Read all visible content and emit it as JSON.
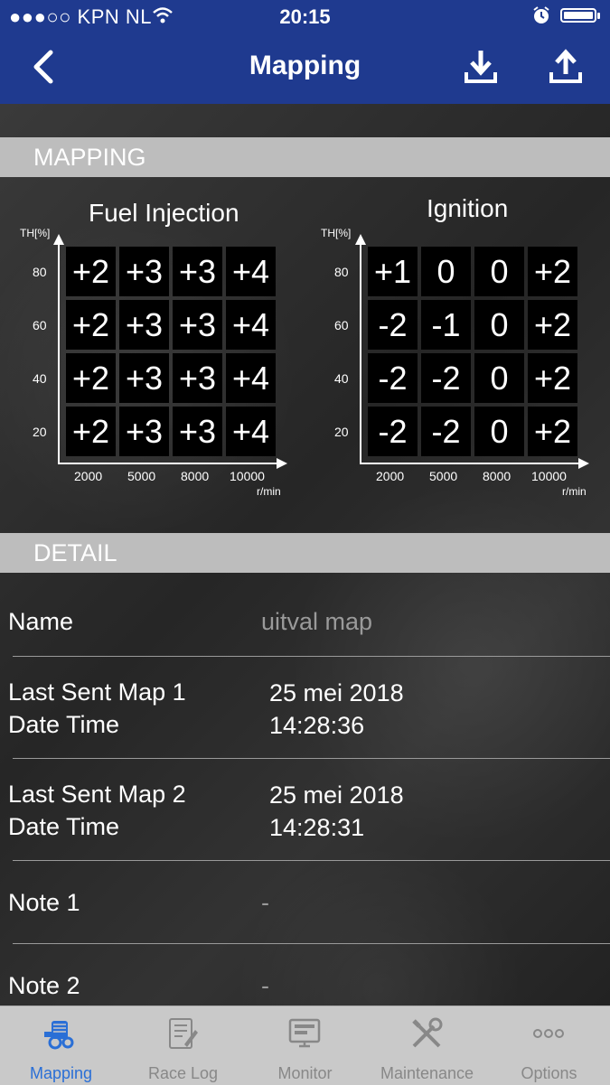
{
  "status_bar": {
    "carrier": "●●●○○ KPN NL",
    "time": "20:15"
  },
  "nav": {
    "title": "Mapping",
    "back_icon": "chevron-left-icon",
    "download_icon": "download-icon",
    "upload_icon": "upload-icon"
  },
  "mapping": {
    "header": "MAPPING",
    "fuel": {
      "title": "Fuel Injection",
      "y_unit": "TH[%]",
      "x_unit": "r/min",
      "y_ticks": [
        "80",
        "60",
        "40",
        "20"
      ],
      "x_ticks": [
        "2000",
        "5000",
        "8000",
        "10000"
      ],
      "rows": [
        [
          "+2",
          "+3",
          "+3",
          "+4"
        ],
        [
          "+2",
          "+3",
          "+3",
          "+4"
        ],
        [
          "+2",
          "+3",
          "+3",
          "+4"
        ],
        [
          "+2",
          "+3",
          "+3",
          "+4"
        ]
      ]
    },
    "ignition": {
      "title": "Ignition",
      "y_unit": "TH[%]",
      "x_unit": "r/min",
      "y_ticks": [
        "80",
        "60",
        "40",
        "20"
      ],
      "x_ticks": [
        "2000",
        "5000",
        "8000",
        "10000"
      ],
      "rows": [
        [
          "+1",
          "0",
          "0",
          "+2"
        ],
        [
          "-2",
          "-1",
          "0",
          "+2"
        ],
        [
          "-2",
          "-2",
          "0",
          "+2"
        ],
        [
          "-2",
          "-2",
          "0",
          "+2"
        ]
      ]
    }
  },
  "detail": {
    "header": "DETAIL",
    "name_label": "Name",
    "name_value": "uitval map",
    "map1_label_1": "Last Sent Map 1",
    "map1_label_2": "Date Time",
    "map1_date": "25 mei 2018",
    "map1_time": "14:28:36",
    "map2_label_1": "Last Sent Map 2",
    "map2_label_2": "Date Time",
    "map2_date": "25 mei 2018",
    "map2_time": "14:28:31",
    "note1_label": "Note 1",
    "note1_value": "-",
    "note2_label": "Note 2",
    "note2_value": "-"
  },
  "tabs": [
    {
      "label": "Mapping",
      "icon": "engine-icon",
      "active": true
    },
    {
      "label": "Race Log",
      "icon": "notepad-icon",
      "active": false
    },
    {
      "label": "Monitor",
      "icon": "monitor-icon",
      "active": false
    },
    {
      "label": "Maintenance",
      "icon": "tools-icon",
      "active": false
    },
    {
      "label": "Options",
      "icon": "more-icon",
      "active": false
    }
  ],
  "colors": {
    "nav_bg": "#1f3a8f",
    "active_tab": "#2a6fd6",
    "section_header": "#bdbdbd"
  }
}
